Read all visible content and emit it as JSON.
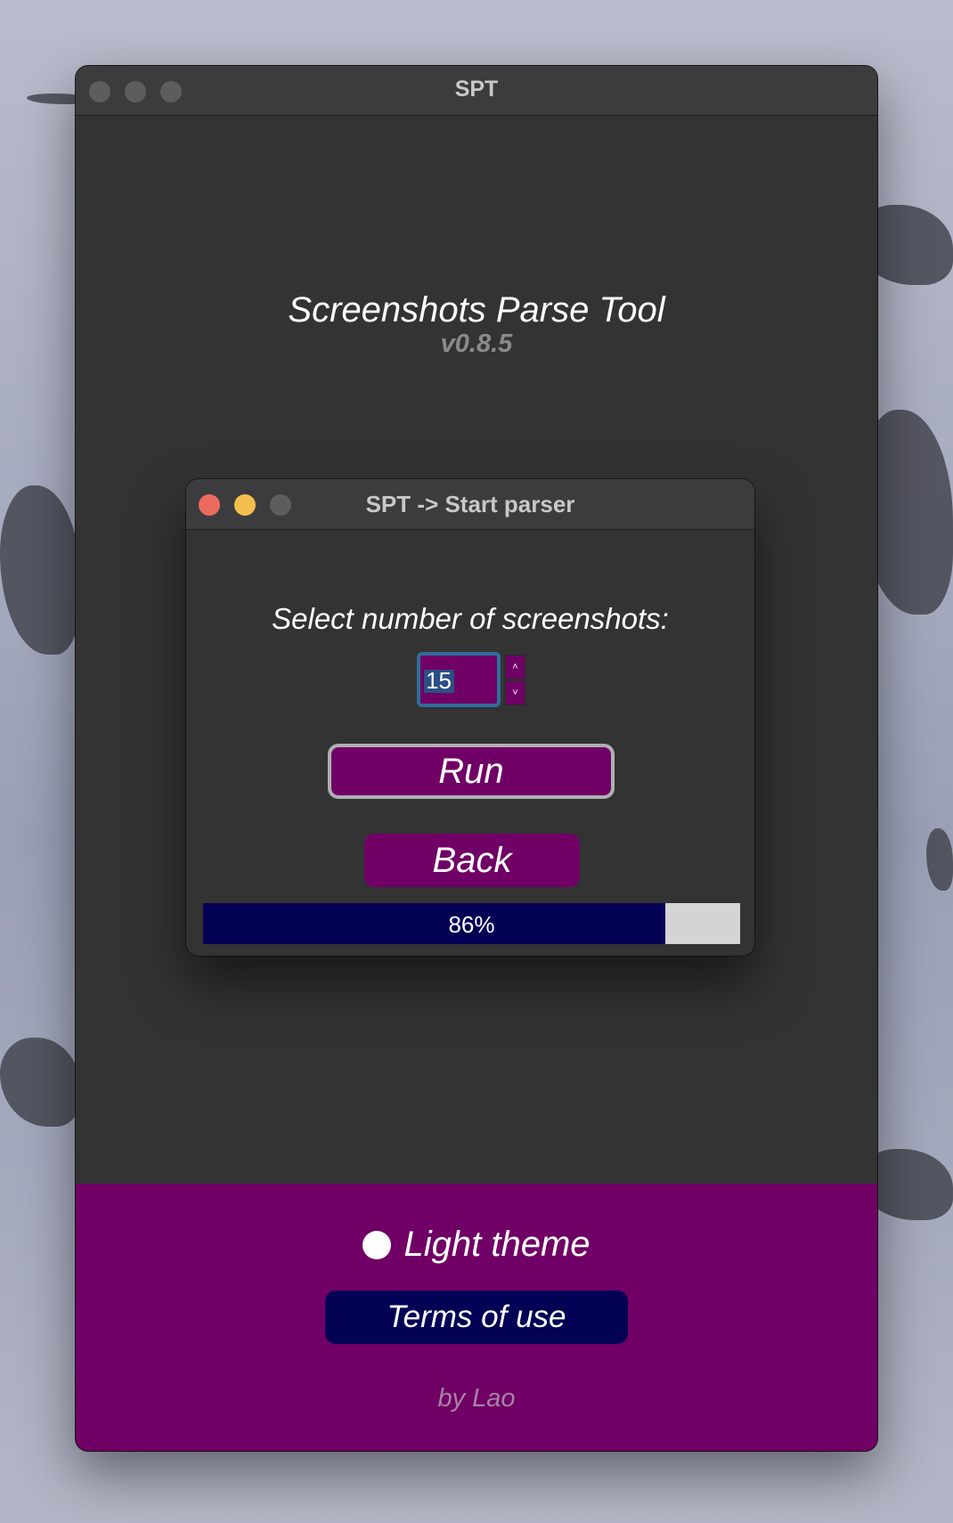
{
  "main_window": {
    "title": "SPT",
    "app_title": "Screenshots Parse Tool",
    "version": "v0.8.5",
    "theme_toggle_label": "Light theme",
    "terms_button": "Terms of use",
    "credit": "by Lao"
  },
  "dialog": {
    "title": "SPT -> Start parser",
    "label": "Select number of screenshots:",
    "screenshot_count": "15",
    "increment_glyph": "˄",
    "decrement_glyph": "˅",
    "run_button": "Run",
    "back_button": "Back",
    "progress_text": "86%",
    "progress_value": 0.86
  },
  "colors": {
    "accent_purple": "#700066",
    "navy": "#040255",
    "window_bg": "#333333",
    "close_red": "#ec6a5e",
    "minimize_yellow": "#f4bf4f"
  }
}
